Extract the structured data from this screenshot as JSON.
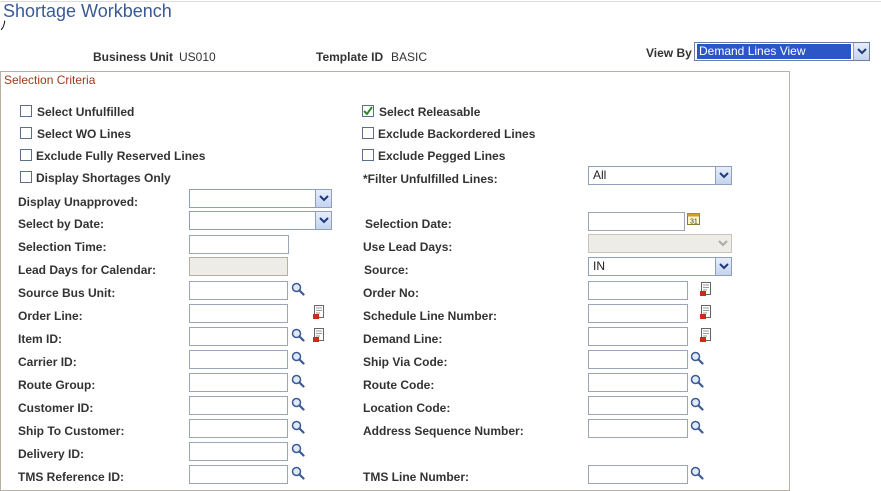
{
  "page_title": "Shortage Workbench",
  "corner_mark": "ﾉ",
  "header": {
    "business_unit_label": "Business Unit",
    "business_unit_value": "US010",
    "template_id_label": "Template ID",
    "template_id_value": "BASIC",
    "view_by_label": "View By",
    "view_by_value": "Demand Lines View"
  },
  "group_title": "Selection Criteria",
  "checkboxes": {
    "select_unfulfilled": {
      "label": "Select Unfulfilled",
      "checked": false
    },
    "select_wo_lines": {
      "label": "Select WO Lines",
      "checked": false
    },
    "exclude_fully_reserved": {
      "label": "Exclude Fully Reserved Lines",
      "checked": false
    },
    "display_shortages_only": {
      "label": "Display Shortages Only",
      "checked": false
    },
    "select_releasable": {
      "label": "Select Releasable",
      "checked": true
    },
    "exclude_backordered": {
      "label": "Exclude Backordered Lines",
      "checked": false
    },
    "exclude_pegged": {
      "label": "Exclude Pegged Lines",
      "checked": false
    }
  },
  "fields": {
    "filter_unfulfilled": {
      "label": "*Filter Unfulfilled Lines:",
      "value": "All"
    },
    "display_unapproved": {
      "label": "Display Unapproved:",
      "value": ""
    },
    "select_by_date": {
      "label": "Select by Date:",
      "value": ""
    },
    "selection_date": {
      "label": "Selection Date:",
      "value": ""
    },
    "selection_time": {
      "label": "Selection Time:",
      "value": ""
    },
    "use_lead_days": {
      "label": "Use Lead Days:",
      "value": ""
    },
    "lead_days_calendar": {
      "label": "Lead Days for Calendar:",
      "value": ""
    },
    "source": {
      "label": "Source:",
      "value": "IN"
    },
    "source_bus_unit": {
      "label": "Source Bus Unit:",
      "value": ""
    },
    "order_no": {
      "label": "Order No:",
      "value": ""
    },
    "order_line": {
      "label": "Order Line:",
      "value": ""
    },
    "schedule_line_number": {
      "label": "Schedule Line Number:",
      "value": ""
    },
    "item_id": {
      "label": "Item ID:",
      "value": ""
    },
    "demand_line": {
      "label": "Demand Line:",
      "value": ""
    },
    "carrier_id": {
      "label": "Carrier ID:",
      "value": ""
    },
    "ship_via_code": {
      "label": "Ship Via Code:",
      "value": ""
    },
    "route_group": {
      "label": "Route Group:",
      "value": ""
    },
    "route_code": {
      "label": "Route Code:",
      "value": ""
    },
    "customer_id": {
      "label": "Customer ID:",
      "value": ""
    },
    "location_code": {
      "label": "Location Code:",
      "value": ""
    },
    "ship_to_customer": {
      "label": "Ship To Customer:",
      "value": ""
    },
    "address_sequence_number": {
      "label": "Address Sequence Number:",
      "value": ""
    },
    "delivery_id": {
      "label": "Delivery ID:",
      "value": ""
    },
    "tms_reference_id": {
      "label": "TMS Reference ID:",
      "value": ""
    },
    "tms_line_number": {
      "label": "TMS Line Number:",
      "value": ""
    }
  },
  "icons": {
    "lookup": "magnifier-icon",
    "prompt": "form-prompt-icon",
    "calendar": "calendar-icon",
    "dropdown": "chevron-down-icon",
    "check": "check-icon"
  },
  "colors": {
    "title": "#3a5a96",
    "group_title": "#9c3a1a",
    "view_by_highlight": "#2c56c8",
    "checkbox_check": "#2d8a2d"
  }
}
